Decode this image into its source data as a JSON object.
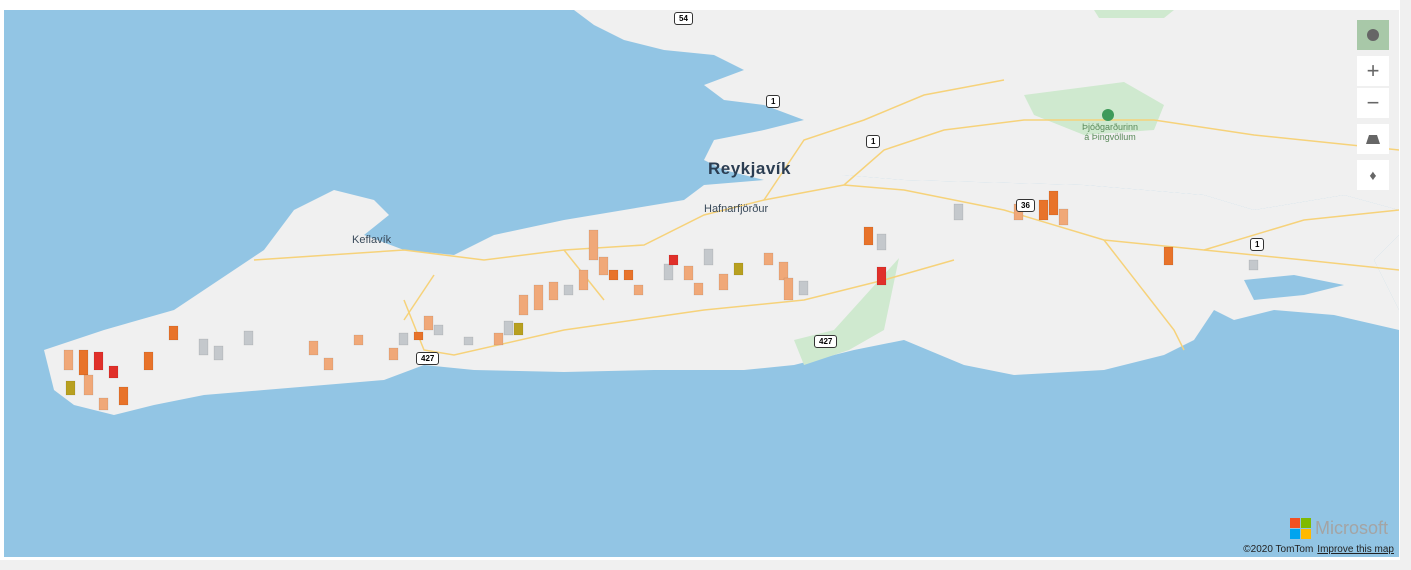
{
  "map": {
    "labels": {
      "reykjavik": "Reykjavík",
      "hafnarfjordur": "Hafnarfjörður",
      "keflavik": "Keflavík",
      "park_line1": "Þjóðgarðurinn",
      "park_line2": "á Þingvöllum"
    },
    "road_shields": [
      "54",
      "1",
      "1",
      "36",
      "1",
      "427",
      "427"
    ],
    "colors": {
      "water": "#92c5e4",
      "land": "#f0f0f0",
      "park": "#cfe9cf",
      "road": "#f6d27a",
      "bar_light": "#f0a878",
      "bar_orange": "#e8732a",
      "bar_red": "#e0302a",
      "bar_gray": "#c4c8cc",
      "bar_olive": "#b8a020"
    }
  },
  "controls": {
    "style_picker": "map-style-icon",
    "zoom_in": "+",
    "zoom_out": "−",
    "pitch": "pitch-icon",
    "compass": "compass-icon"
  },
  "footer": {
    "brand": "Microsoft",
    "copyright": "©2020 TomTom",
    "improve_link": "Improve this map"
  }
}
